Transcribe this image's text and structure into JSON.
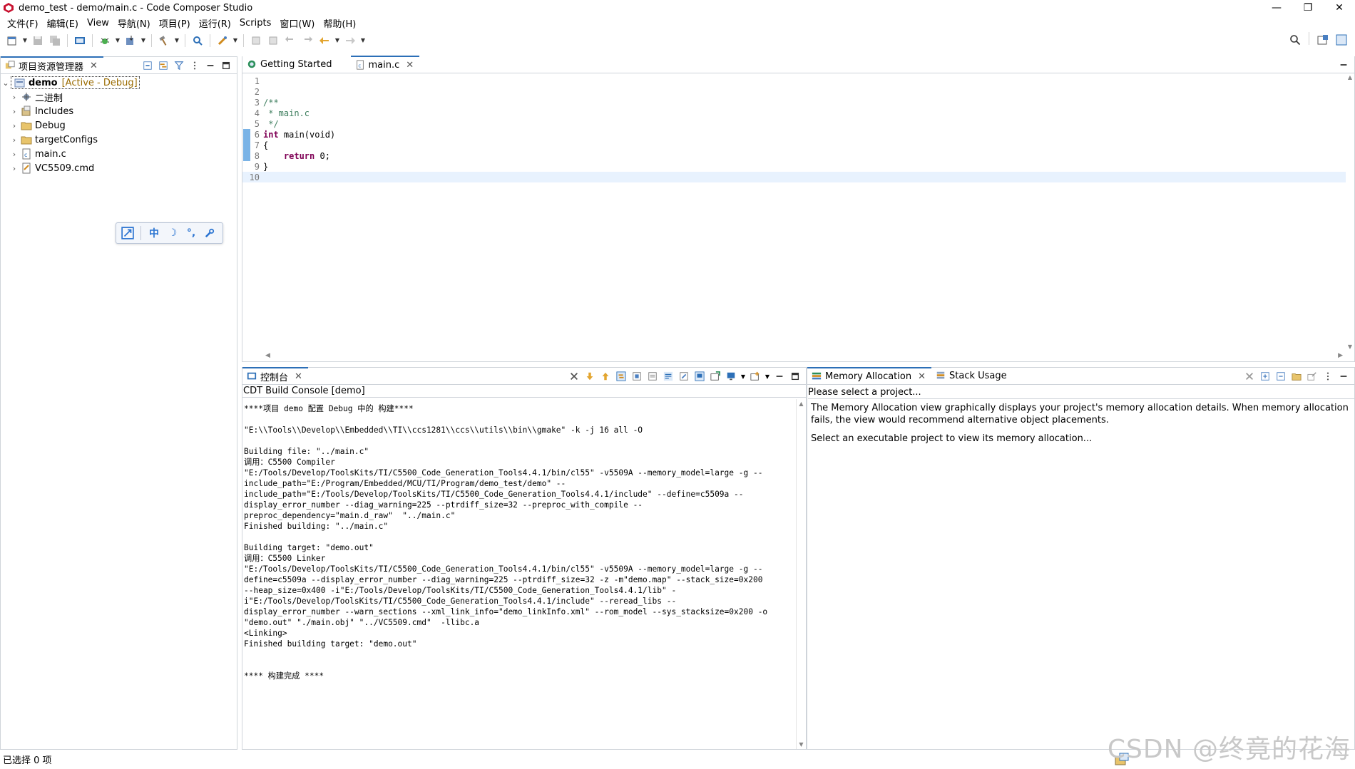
{
  "window": {
    "title": "demo_test - demo/main.c - Code Composer Studio",
    "controls": [
      "—",
      "❐",
      "✕"
    ]
  },
  "menu": [
    "文件(F)",
    "编辑(E)",
    "View",
    "导航(N)",
    "项目(P)",
    "运行(R)",
    "Scripts",
    "窗口(W)",
    "帮助(H)"
  ],
  "explorer": {
    "tab_label": "项目资源管理器",
    "root": {
      "name": "demo",
      "status": "[Active - Debug]"
    },
    "items": [
      {
        "label": "二进制",
        "icon": "binaries-icon"
      },
      {
        "label": "Includes",
        "icon": "includes-icon"
      },
      {
        "label": "Debug",
        "icon": "folder-icon"
      },
      {
        "label": "targetConfigs",
        "icon": "folder-icon"
      },
      {
        "label": "main.c",
        "icon": "c-file-icon"
      },
      {
        "label": "VC5509.cmd",
        "icon": "cmd-file-icon"
      }
    ]
  },
  "ime": {
    "mode": "中",
    "moon": "☽",
    "punct": "°,",
    "tool": "🔧"
  },
  "editor": {
    "tabs": [
      {
        "label": "Getting Started",
        "icon": "ccs-globe-icon",
        "active": false
      },
      {
        "label": "main.c",
        "icon": "c-file-icon",
        "active": true
      }
    ],
    "lines": [
      {
        "n": "1",
        "parts": []
      },
      {
        "n": "2",
        "parts": []
      },
      {
        "n": "3",
        "parts": [
          {
            "t": "/**",
            "c": "cmt"
          }
        ]
      },
      {
        "n": "4",
        "parts": [
          {
            "t": " * main.c",
            "c": "cmt"
          }
        ]
      },
      {
        "n": "5",
        "parts": [
          {
            "t": " */",
            "c": "cmt"
          }
        ]
      },
      {
        "n": "6",
        "parts": [
          {
            "t": "int",
            "c": "kw"
          },
          {
            "t": " main(void)",
            "c": ""
          }
        ]
      },
      {
        "n": "7",
        "parts": [
          {
            "t": "{",
            "c": ""
          }
        ]
      },
      {
        "n": "8",
        "parts": [
          {
            "t": "    ",
            "c": ""
          },
          {
            "t": "return",
            "c": "kw"
          },
          {
            "t": " 0;",
            "c": ""
          }
        ]
      },
      {
        "n": "9",
        "parts": [
          {
            "t": "}",
            "c": ""
          }
        ]
      },
      {
        "n": "10",
        "parts": []
      }
    ],
    "current_line": "10"
  },
  "console": {
    "tab_label": "控制台",
    "subtitle": "CDT Build Console [demo]",
    "text": "****项目 demo 配置 Debug 中的 构建****\n\n\"E:\\\\Tools\\\\Develop\\\\Embedded\\\\TI\\\\ccs1281\\\\ccs\\\\utils\\\\bin\\\\gmake\" -k -j 16 all -O\n\nBuilding file: \"../main.c\"\n调用：C5500 Compiler\n\"E:/Tools/Develop/ToolsKits/TI/C5500_Code_Generation_Tools4.4.1/bin/cl55\" -v5509A --memory_model=large -g --\ninclude_path=\"E:/Program/Embedded/MCU/TI/Program/demo_test/demo\" --\ninclude_path=\"E:/Tools/Develop/ToolsKits/TI/C5500_Code_Generation_Tools4.4.1/include\" --define=c5509a --\ndisplay_error_number --diag_warning=225 --ptrdiff_size=32 --preproc_with_compile --\npreproc_dependency=\"main.d_raw\"  \"../main.c\"\nFinished building: \"../main.c\"\n\nBuilding target: \"demo.out\"\n调用：C5500 Linker\n\"E:/Tools/Develop/ToolsKits/TI/C5500_Code_Generation_Tools4.4.1/bin/cl55\" -v5509A --memory_model=large -g --\ndefine=c5509a --display_error_number --diag_warning=225 --ptrdiff_size=32 -z -m\"demo.map\" --stack_size=0x200\n--heap_size=0x400 -i\"E:/Tools/Develop/ToolsKits/TI/C5500_Code_Generation_Tools4.4.1/lib\" -\ni\"E:/Tools/Develop/ToolsKits/TI/C5500_Code_Generation_Tools4.4.1/include\" --reread_libs --\ndisplay_error_number --warn_sections --xml_link_info=\"demo_linkInfo.xml\" --rom_model --sys_stacksize=0x200 -o\n\"demo.out\" \"./main.obj\" \"../VC5509.cmd\"  -llibc.a\n<Linking>\nFinished building target: \"demo.out\"\n\n\n**** 构建完成 ****"
  },
  "memory": {
    "tabs": [
      {
        "label": "Memory Allocation",
        "active": true
      },
      {
        "label": "Stack Usage",
        "active": false
      }
    ],
    "select_project": "Please select a project...",
    "description": "The Memory Allocation view graphically displays your project's memory allocation details. When memory allocation fails, the view would recommend alternative object placements.",
    "instruction": "Select an executable project to view its memory allocation..."
  },
  "status": {
    "text": "已选择 0 项"
  },
  "watermark": "CSDN @终竟的花海",
  "colors": {
    "accent": "#2c6fb7",
    "comment": "#3f7f5f",
    "keyword": "#7f0055",
    "fold": "#7ab3e6"
  }
}
